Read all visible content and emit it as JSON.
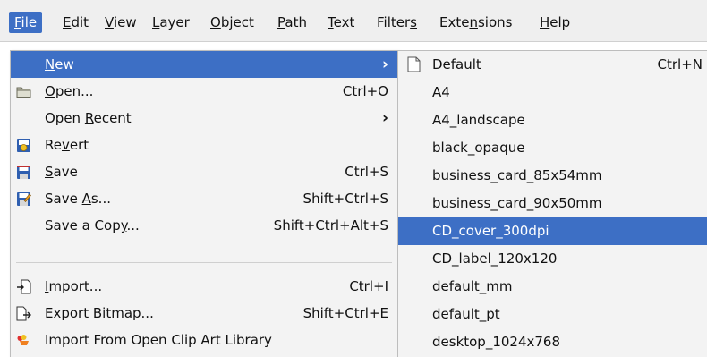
{
  "menubar": {
    "items": [
      {
        "pre": "",
        "key": "F",
        "post": "ile"
      },
      {
        "pre": "",
        "key": "E",
        "post": "dit"
      },
      {
        "pre": "",
        "key": "V",
        "post": "iew"
      },
      {
        "pre": "",
        "key": "L",
        "post": "ayer"
      },
      {
        "pre": "",
        "key": "O",
        "post": "bject"
      },
      {
        "pre": "",
        "key": "P",
        "post": "ath"
      },
      {
        "pre": "",
        "key": "T",
        "post": "ext"
      },
      {
        "pre": "Filter",
        "key": "s",
        "post": ""
      },
      {
        "pre": "Exte",
        "key": "n",
        "post": "sions"
      },
      {
        "pre": "",
        "key": "H",
        "post": "elp"
      }
    ]
  },
  "file_menu": {
    "items": [
      {
        "pre": "",
        "key": "N",
        "post": "ew",
        "shortcut": ""
      },
      {
        "pre": "",
        "key": "O",
        "post": "pen...",
        "shortcut": "Ctrl+O"
      },
      {
        "pre": "Open ",
        "key": "R",
        "post": "ecent",
        "shortcut": ""
      },
      {
        "pre": "Re",
        "key": "v",
        "post": "ert",
        "shortcut": ""
      },
      {
        "pre": "",
        "key": "S",
        "post": "ave",
        "shortcut": "Ctrl+S"
      },
      {
        "pre": "Save ",
        "key": "A",
        "post": "s...",
        "shortcut": "Shift+Ctrl+S"
      },
      {
        "pre": "Save a Cop",
        "key": "y",
        "post": "...",
        "shortcut": "Shift+Ctrl+Alt+S"
      },
      {
        "pre": "",
        "key": "I",
        "post": "mport...",
        "shortcut": "Ctrl+I"
      },
      {
        "pre": "",
        "key": "E",
        "post": "xport Bitmap...",
        "shortcut": "Shift+Ctrl+E"
      },
      {
        "pre": "Import From Open Clip Art Library",
        "key": "",
        "post": "",
        "shortcut": ""
      }
    ]
  },
  "new_submenu": {
    "items": [
      {
        "label": "Default",
        "shortcut": "Ctrl+N"
      },
      {
        "label": "A4",
        "shortcut": ""
      },
      {
        "label": "A4_landscape",
        "shortcut": ""
      },
      {
        "label": "black_opaque",
        "shortcut": ""
      },
      {
        "label": "business_card_85x54mm",
        "shortcut": ""
      },
      {
        "label": "business_card_90x50mm",
        "shortcut": ""
      },
      {
        "label": "CD_cover_300dpi",
        "shortcut": ""
      },
      {
        "label": "CD_label_120x120",
        "shortcut": ""
      },
      {
        "label": "default_mm",
        "shortcut": ""
      },
      {
        "label": "default_pt",
        "shortcut": ""
      },
      {
        "label": "desktop_1024x768",
        "shortcut": ""
      }
    ]
  },
  "icons": {
    "open": "folder-icon",
    "revert": "revert-icon",
    "save": "floppy-icon",
    "save_as": "floppy-pencil-icon",
    "import": "import-icon",
    "export": "export-icon",
    "clipart": "clipart-icon",
    "default_template": "document-icon"
  },
  "colors": {
    "highlight": "#3d6fc5",
    "menu_bg": "#f3f3f3",
    "menubar_bg": "#efefef"
  }
}
